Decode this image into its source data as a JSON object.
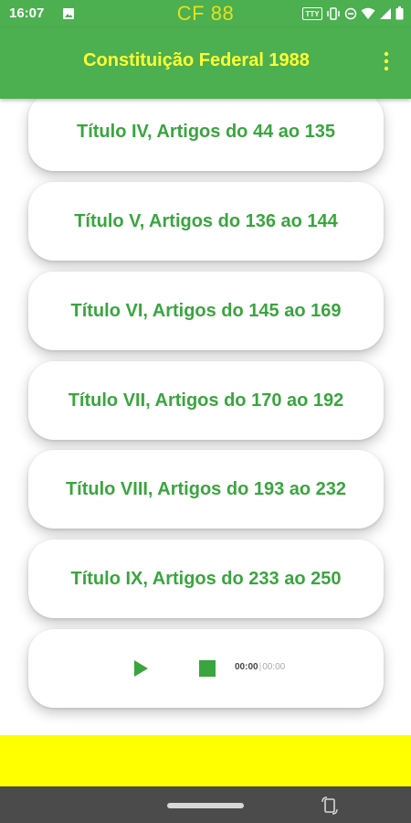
{
  "status_bar": {
    "time": "16:07",
    "app_label": "CF 88",
    "icons": [
      "photo-icon",
      "tty-icon",
      "vibrate-icon",
      "dnd-icon",
      "wifi-icon",
      "signal-icon",
      "battery-icon"
    ],
    "tty_text": "TTY"
  },
  "app_bar": {
    "title": "Constituição Federal 1988",
    "menu_icon": "more-vert-icon",
    "background": "#4caf50",
    "title_color": "#ffff33"
  },
  "titles": [
    {
      "label": "Título IV, Artigos do 44 ao 135"
    },
    {
      "label": "Título V, Artigos do 136 ao 144"
    },
    {
      "label": "Título VI, Artigos do 145 ao 169"
    },
    {
      "label": "Título VII, Artigos do 170 ao 192"
    },
    {
      "label": "Título VIII, Artigos do 193 ao 232"
    },
    {
      "label": "Título IX, Artigos do 233 ao 250"
    }
  ],
  "player": {
    "current_time": "00:00",
    "separator": "|",
    "total_time": "00:00",
    "play_icon": "play-icon",
    "stop_icon": "stop-icon",
    "accent": "#3aa53f"
  },
  "ad_banner": {
    "background": "#ffff00"
  },
  "nav_bar": {
    "rotate_icon": "rotate-icon"
  }
}
